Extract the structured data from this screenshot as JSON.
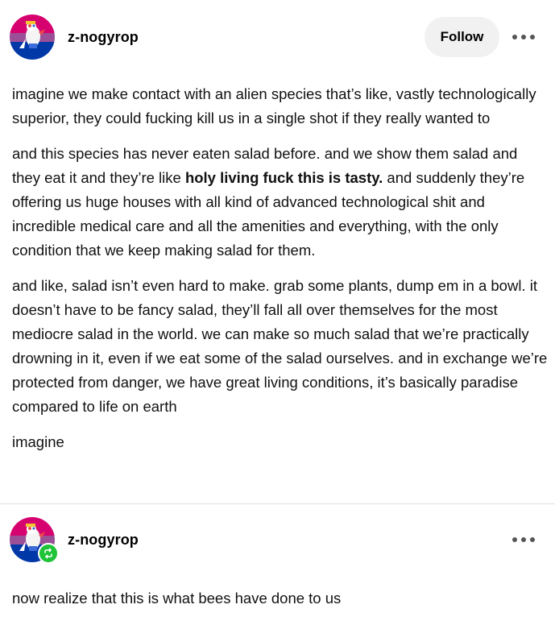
{
  "post": {
    "username": "z-nogyrop",
    "follow_label": "Follow",
    "paragraphs": [
      {
        "text": "imagine we make contact with an alien species that’s like, vastly technologically superior, they could fucking kill us in a single shot if they really wanted to"
      },
      {
        "before": "and this species has never eaten salad before. and we show them salad and they eat it and they’re like ",
        "bold": "holy living fuck this is tasty.",
        "after": " and suddenly they’re offering us huge houses with all kind of advanced technological shit and incredible medical care and all the amenities and everything, with the only condition that we keep making salad for them."
      },
      {
        "text": "and like, salad isn’t even hard to make. grab some plants, dump em in a bowl. it doesn’t have to be fancy salad, they’ll fall all over themselves for the most mediocre salad in the world. we can make so much salad that we’re practically drowning in it, even if we eat some of the salad ourselves. and in exchange we’re protected from danger, we have great living conditions, it’s basically paradise compared to life on earth"
      },
      {
        "text": "imagine"
      }
    ]
  },
  "reblog": {
    "username": "z-nogyrop",
    "text": "now realize that this is what bees have done to us"
  },
  "icons": {
    "more": "more-options-icon",
    "reblog": "reblog-icon",
    "avatar": "avatar"
  },
  "colors": {
    "follow_bg": "#f1f1f1",
    "reblog_green": "#1ec337",
    "avatar_pink": "#d6026f",
    "avatar_purple": "#9b4f96",
    "avatar_blue": "#0038a8"
  }
}
